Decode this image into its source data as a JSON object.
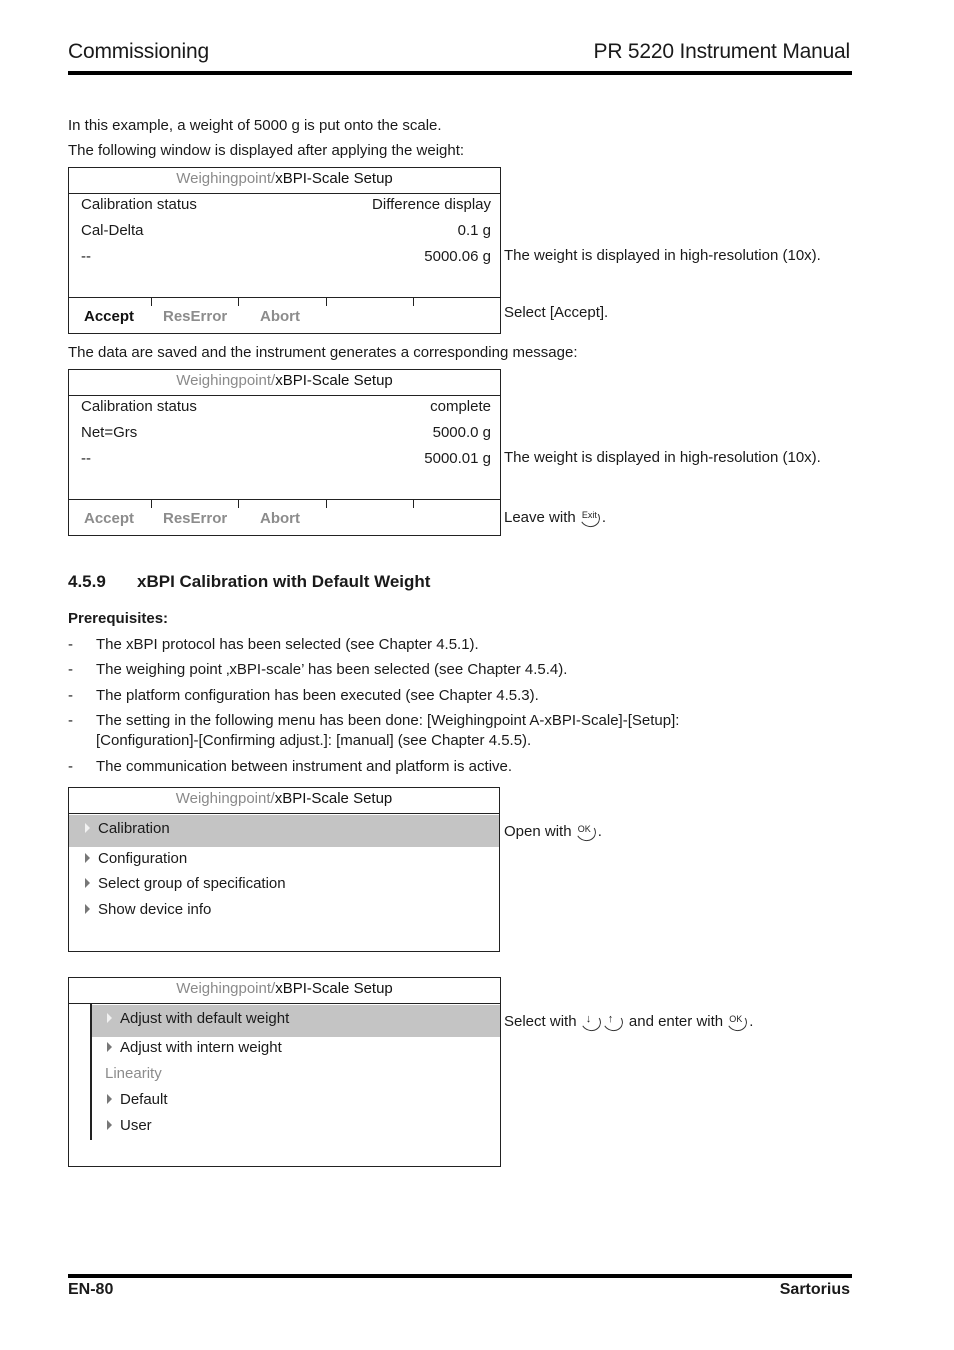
{
  "header": {
    "left": "Commissioning",
    "right": "PR 5220 Instrument Manual"
  },
  "footer": {
    "left": "EN-80",
    "right": "Sartorius"
  },
  "intro": {
    "line1": "In this example, a weight of 5000 g is put onto the scale.",
    "line2": "The following window is displayed after applying the weight:"
  },
  "screen1": {
    "crumb": "Weighingpoint/",
    "title": "xBPI-Scale Setup",
    "rows": [
      {
        "label": "Calibration status",
        "value": "Difference display"
      },
      {
        "label": "Cal-Delta",
        "value": "0.1 g"
      },
      {
        "label": "--",
        "value": "5000.06 g"
      }
    ],
    "softkeys": [
      {
        "label": "Accept",
        "enabled": true
      },
      {
        "label": "ResError",
        "enabled": false
      },
      {
        "label": "Abort",
        "enabled": false
      }
    ],
    "note_weight": "The weight is displayed in high-resolution (10x).",
    "note_action": "Select [Accept]."
  },
  "between": "The data are saved and the instrument generates a corresponding message:",
  "screen2": {
    "crumb": "Weighingpoint/",
    "title": "xBPI-Scale Setup",
    "rows": [
      {
        "label": "Calibration status",
        "value": "complete"
      },
      {
        "label": "Net=Grs",
        "value": "5000.0 g"
      },
      {
        "label": "--",
        "value": "5000.01 g"
      }
    ],
    "softkeys": [
      {
        "label": "Accept",
        "enabled": false
      },
      {
        "label": "ResError",
        "enabled": false
      },
      {
        "label": "Abort",
        "enabled": false
      }
    ],
    "note_weight": "The weight is displayed in high-resolution (10x).",
    "note_action_prefix": "Leave with",
    "note_action_key": "Exit",
    "note_action_suffix": "."
  },
  "section": {
    "number": "4.5.9",
    "title": "xBPI Calibration with Default Weight",
    "prereq_label": "Prerequisites:",
    "bullet": "-",
    "prereqs": [
      "The xBPI protocol has been selected (see Chapter 4.5.1).",
      "The weighing point ‚xBPI-scale’ has been selected (see Chapter 4.5.4).",
      "The platform configuration has been executed (see Chapter 4.5.3).",
      "The setting in the following menu has been done: [Weighingpoint A-xBPI-Scale]-[Setup]:",
      "The communication between instrument and platform is active."
    ],
    "prereq4_cont": "[Configuration]-[Confirming adjust.]: [manual] (see Chapter 4.5.5)."
  },
  "screen3": {
    "crumb": "Weighingpoint/",
    "title": "xBPI-Scale Setup",
    "items": [
      "Calibration",
      "Configuration",
      "Select group of specification",
      "Show device info"
    ],
    "selected_index": 0,
    "note_prefix": "Open with",
    "note_key": "OK",
    "note_suffix": "."
  },
  "screen4": {
    "crumb": "Weighingpoint/",
    "title": "xBPI-Scale Setup",
    "items": [
      "Adjust with default weight",
      "Adjust with intern weight"
    ],
    "group_label": "Linearity",
    "group_items": [
      "Default",
      "User"
    ],
    "selected_index": 0,
    "note_prefix": "Select with",
    "note_key_down": "↓",
    "note_key_up": "↑",
    "note_mid": "and enter with",
    "note_key_ok": "OK",
    "note_suffix": "."
  }
}
